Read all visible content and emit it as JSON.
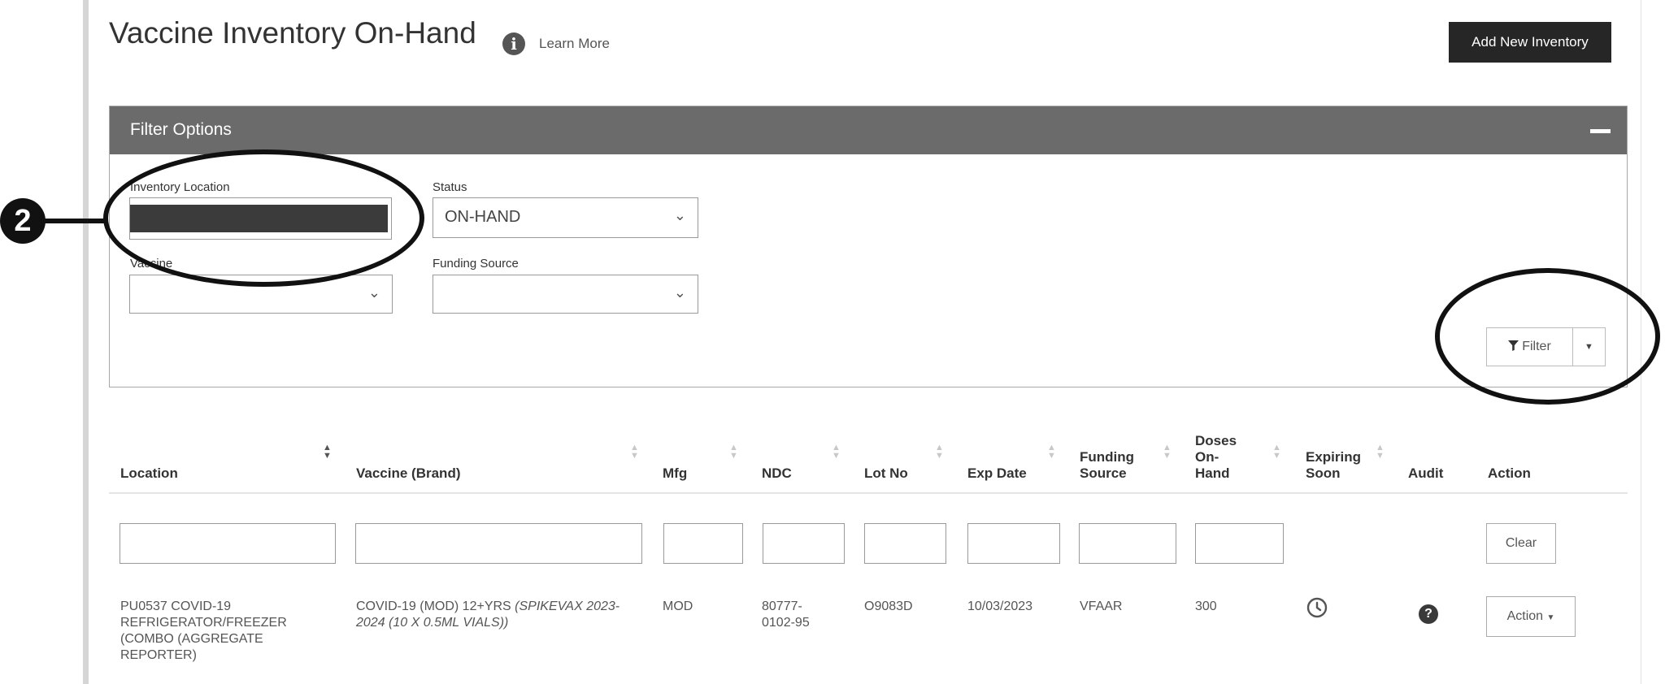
{
  "header": {
    "title": "Vaccine Inventory On-Hand",
    "info_icon": "info-circle-icon",
    "learn_more": "Learn More",
    "add_button": "Add New Inventory"
  },
  "filter": {
    "title": "Filter Options",
    "location_label": "Inventory Location",
    "status_label": "Status",
    "status_value": "ON-HAND",
    "vaccine_label": "Vaccine",
    "funding_label": "Funding Source",
    "filter_button": "Filter"
  },
  "table": {
    "columns": [
      "Location",
      "Vaccine (Brand)",
      "Mfg",
      "NDC",
      "Lot No",
      "Exp Date",
      "Funding Source",
      "Doses On-Hand",
      "Expiring Soon",
      "Audit",
      "Action"
    ],
    "clear_button": "Clear",
    "rows": [
      {
        "location": "PU0537 COVID-19 REFRIGERATOR/FREEZER (COMBO (AGGREGATE REPORTER)",
        "vaccine": "COVID-19 (MOD) 12+YRS",
        "brand": "(SPIKEVAX 2023-2024 (10 X 0.5ML VIALS))",
        "mfg": "MOD",
        "ndc": "80777-0102-95",
        "lot": "O9083D",
        "exp": "10/03/2023",
        "funding": "VFAAR",
        "doses": "300",
        "expiring_icon": "clock-icon",
        "audit_icon": "question-circle-icon",
        "action": "Action"
      }
    ]
  },
  "callout": {
    "number": "2"
  }
}
